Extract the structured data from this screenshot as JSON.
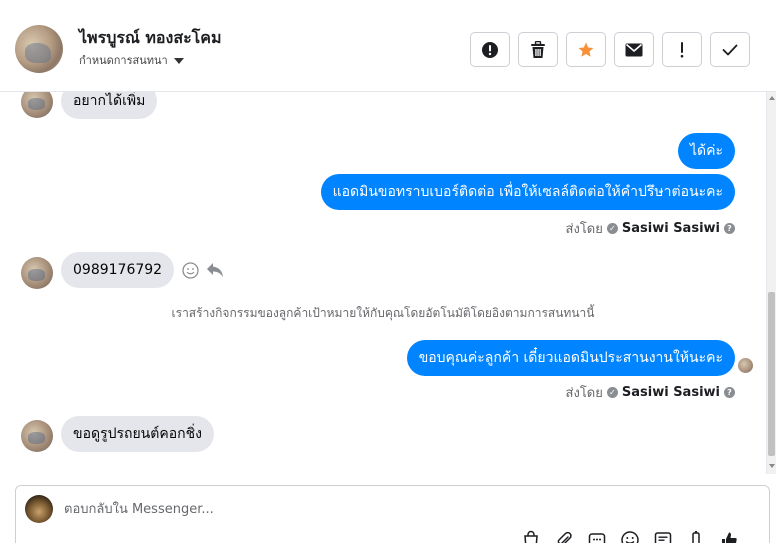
{
  "header": {
    "contact_name": "ไพรบูรณ์ ทองสะโคม",
    "settings_label": "กำหนดการสนทนา",
    "actions": [
      {
        "name": "report-spam-button",
        "icon": "exclamation-circle-icon"
      },
      {
        "name": "delete-button",
        "icon": "trash-icon"
      },
      {
        "name": "star-button",
        "icon": "star-icon"
      },
      {
        "name": "mark-unread-button",
        "icon": "envelope-icon"
      },
      {
        "name": "follow-up-button",
        "icon": "exclamation-icon"
      },
      {
        "name": "mark-done-button",
        "icon": "check-icon"
      }
    ]
  },
  "colors": {
    "accent_blue": "#0084ff",
    "star_orange": "#f7923a",
    "incoming_bubble": "#e4e6eb"
  },
  "messages": {
    "m1": "อยากได้เพิ่ม",
    "m2": "ได้ค่ะ",
    "m3": "แอดมินขอทราบเบอร์ติดต่อ เพื่อให้เซลล์ติดต่อให้คำปรึษาต่อนะคะ",
    "m4": "0989176792",
    "m5": "ขอบคุณค่ะลูกค้า เดี๋ยวแอดมินประสานงานให้นะคะ",
    "m6": "ขอดูรูปรถยนต์คอกชิ่ง"
  },
  "sent_by": {
    "prefix": "ส่งโดย",
    "name": "Sasiwi Sasiwi"
  },
  "system_note": "เราสร้างกิจกรรมของลูกค้าเป้าหมายให้กับคุณโดยอัตโนมัติโดยอิงตามการสนทนานี้",
  "composer": {
    "placeholder": "ตอบกลับใน Messenger...",
    "tools": [
      "shopping-bag-icon",
      "attachment-icon",
      "saved-replies-icon",
      "emoji-icon",
      "message-template-icon",
      "bot-icon",
      "like-icon"
    ]
  }
}
